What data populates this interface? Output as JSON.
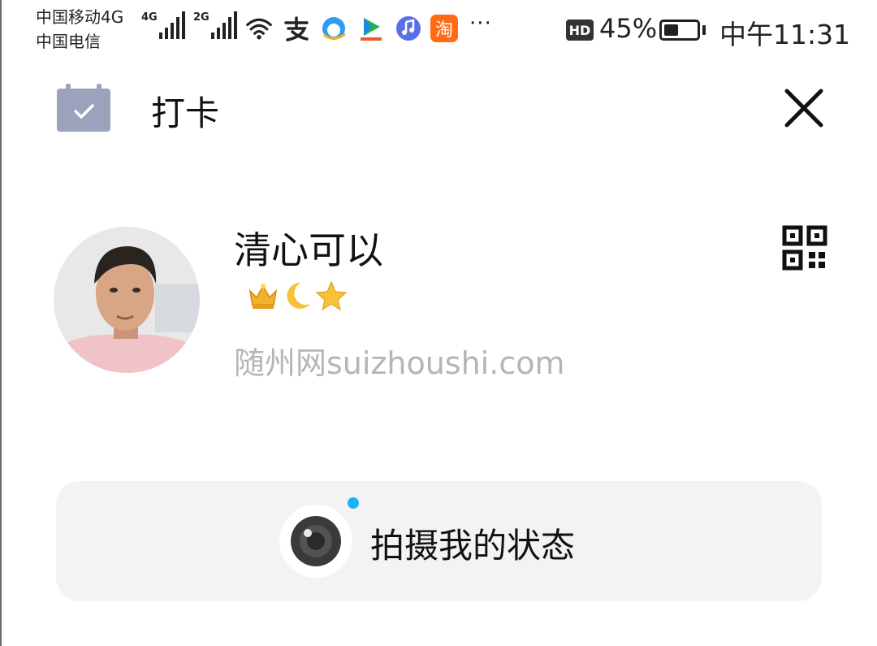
{
  "status_bar": {
    "carrier_1": "中国移动4G",
    "carrier_2": "中国电信",
    "signal_1_tag": "4G",
    "signal_2_tag": "2G",
    "hd_badge": "HD",
    "battery_percent": "45%",
    "battery_level": 0.45,
    "time": "中午11:31",
    "more_indicator": "···",
    "app_icons": [
      "wifi-icon",
      "alipay-icon",
      "browser-icon",
      "video-app-icon",
      "music-app-icon",
      "taobao-icon"
    ],
    "taobao_label": "淘"
  },
  "header": {
    "title": "打卡",
    "left_icon": "calendar-check-icon",
    "close_icon": "close-icon"
  },
  "profile": {
    "name": "清心可以",
    "badges": [
      "crown-icon",
      "moon-icon",
      "star-icon"
    ],
    "signature": "随州网suizhoushi.com",
    "qr_icon": "qr-code-icon"
  },
  "action": {
    "label": "拍摄我的状态",
    "icon": "camera-lens-icon"
  },
  "colors": {
    "accent_dot": "#18b4f4",
    "card_bg": "#f3f3f3",
    "calendar_icon": "#9aa3bb",
    "signature_text": "#b5b5b5"
  }
}
